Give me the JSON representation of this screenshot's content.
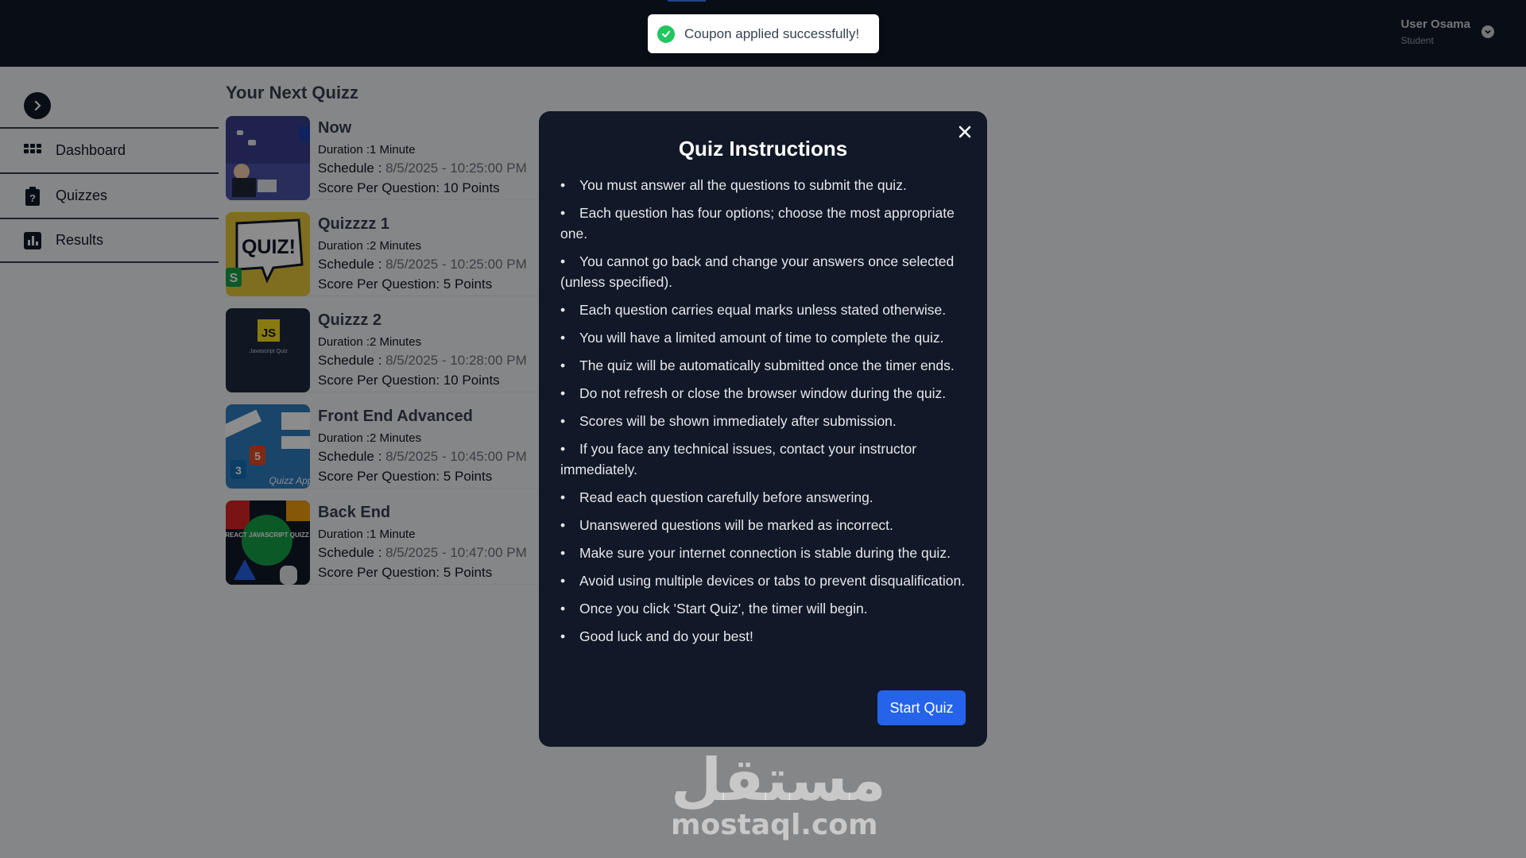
{
  "header": {
    "user_name": "User Osama",
    "user_role": "Student"
  },
  "sidebar": {
    "items": [
      {
        "label": "Dashboard",
        "icon": "grid-icon"
      },
      {
        "label": "Quizzes",
        "icon": "clipboard-question-icon"
      },
      {
        "label": "Results",
        "icon": "bar-chart-icon"
      }
    ]
  },
  "main": {
    "title": "Your Next Quizz",
    "schedule_label": "Schedule : ",
    "quizzes": [
      {
        "name": "Now",
        "duration": "Duration :1 Minute",
        "schedule": "8/5/2025 - 10:25:00 PM",
        "score": "Score Per Question: 10 Points"
      },
      {
        "name": "Quizzzz 1",
        "duration": "Duration :2 Minutes",
        "schedule": "8/5/2025 - 10:25:00 PM",
        "score": "Score Per Question: 5 Points"
      },
      {
        "name": "Quizzz 2",
        "duration": "Duration :2 Minutes",
        "schedule": "8/5/2025 - 10:28:00 PM",
        "score": "Score Per Question: 10 Points"
      },
      {
        "name": "Front End Advanced",
        "duration": "Duration :2 Minutes",
        "schedule": "8/5/2025 - 10:45:00 PM",
        "score": "Score Per Question: 5 Points"
      },
      {
        "name": "Back End",
        "duration": "Duration :1 Minute",
        "schedule": "8/5/2025 - 10:47:00 PM",
        "score": "Score Per Question: 5 Points"
      }
    ],
    "thumb_text": {
      "quiz1": "QUIZ!",
      "quiz2": "JS",
      "quiz2_sub": "Javascript Quiz",
      "frontend": "Quizz App",
      "backend": "REACT JAVASCRIPT QUIZZ"
    }
  },
  "toast": {
    "message": "Coupon applied successfully!"
  },
  "modal": {
    "title": "Quiz Instructions",
    "rules": [
      "You must answer all the questions to submit the quiz.",
      "Each question has four options; choose the most appropriate one.",
      "You cannot go back and change your answers once selected (unless specified).",
      "Each question carries equal marks unless stated otherwise.",
      "You will have a limited amount of time to complete the quiz.",
      "The quiz will be automatically submitted once the timer ends.",
      "Do not refresh or close the browser window during the quiz.",
      "Scores will be shown immediately after submission.",
      "If you face any technical issues, contact your instructor immediately.",
      "Read each question carefully before answering.",
      "Unanswered questions will be marked as incorrect.",
      "Make sure your internet connection is stable during the quiz.",
      "Avoid using multiple devices or tabs to prevent disqualification.",
      "Once you click 'Start Quiz', the timer will begin.",
      "Good luck and do your best!"
    ],
    "start_label": "Start Quiz"
  },
  "watermark": {
    "arabic": "مستقل",
    "latin": "mostaql.com"
  },
  "colors": {
    "header_bg": "#111827",
    "modal_bg": "#111827",
    "primary": "#2563eb",
    "success": "#22c55e"
  }
}
